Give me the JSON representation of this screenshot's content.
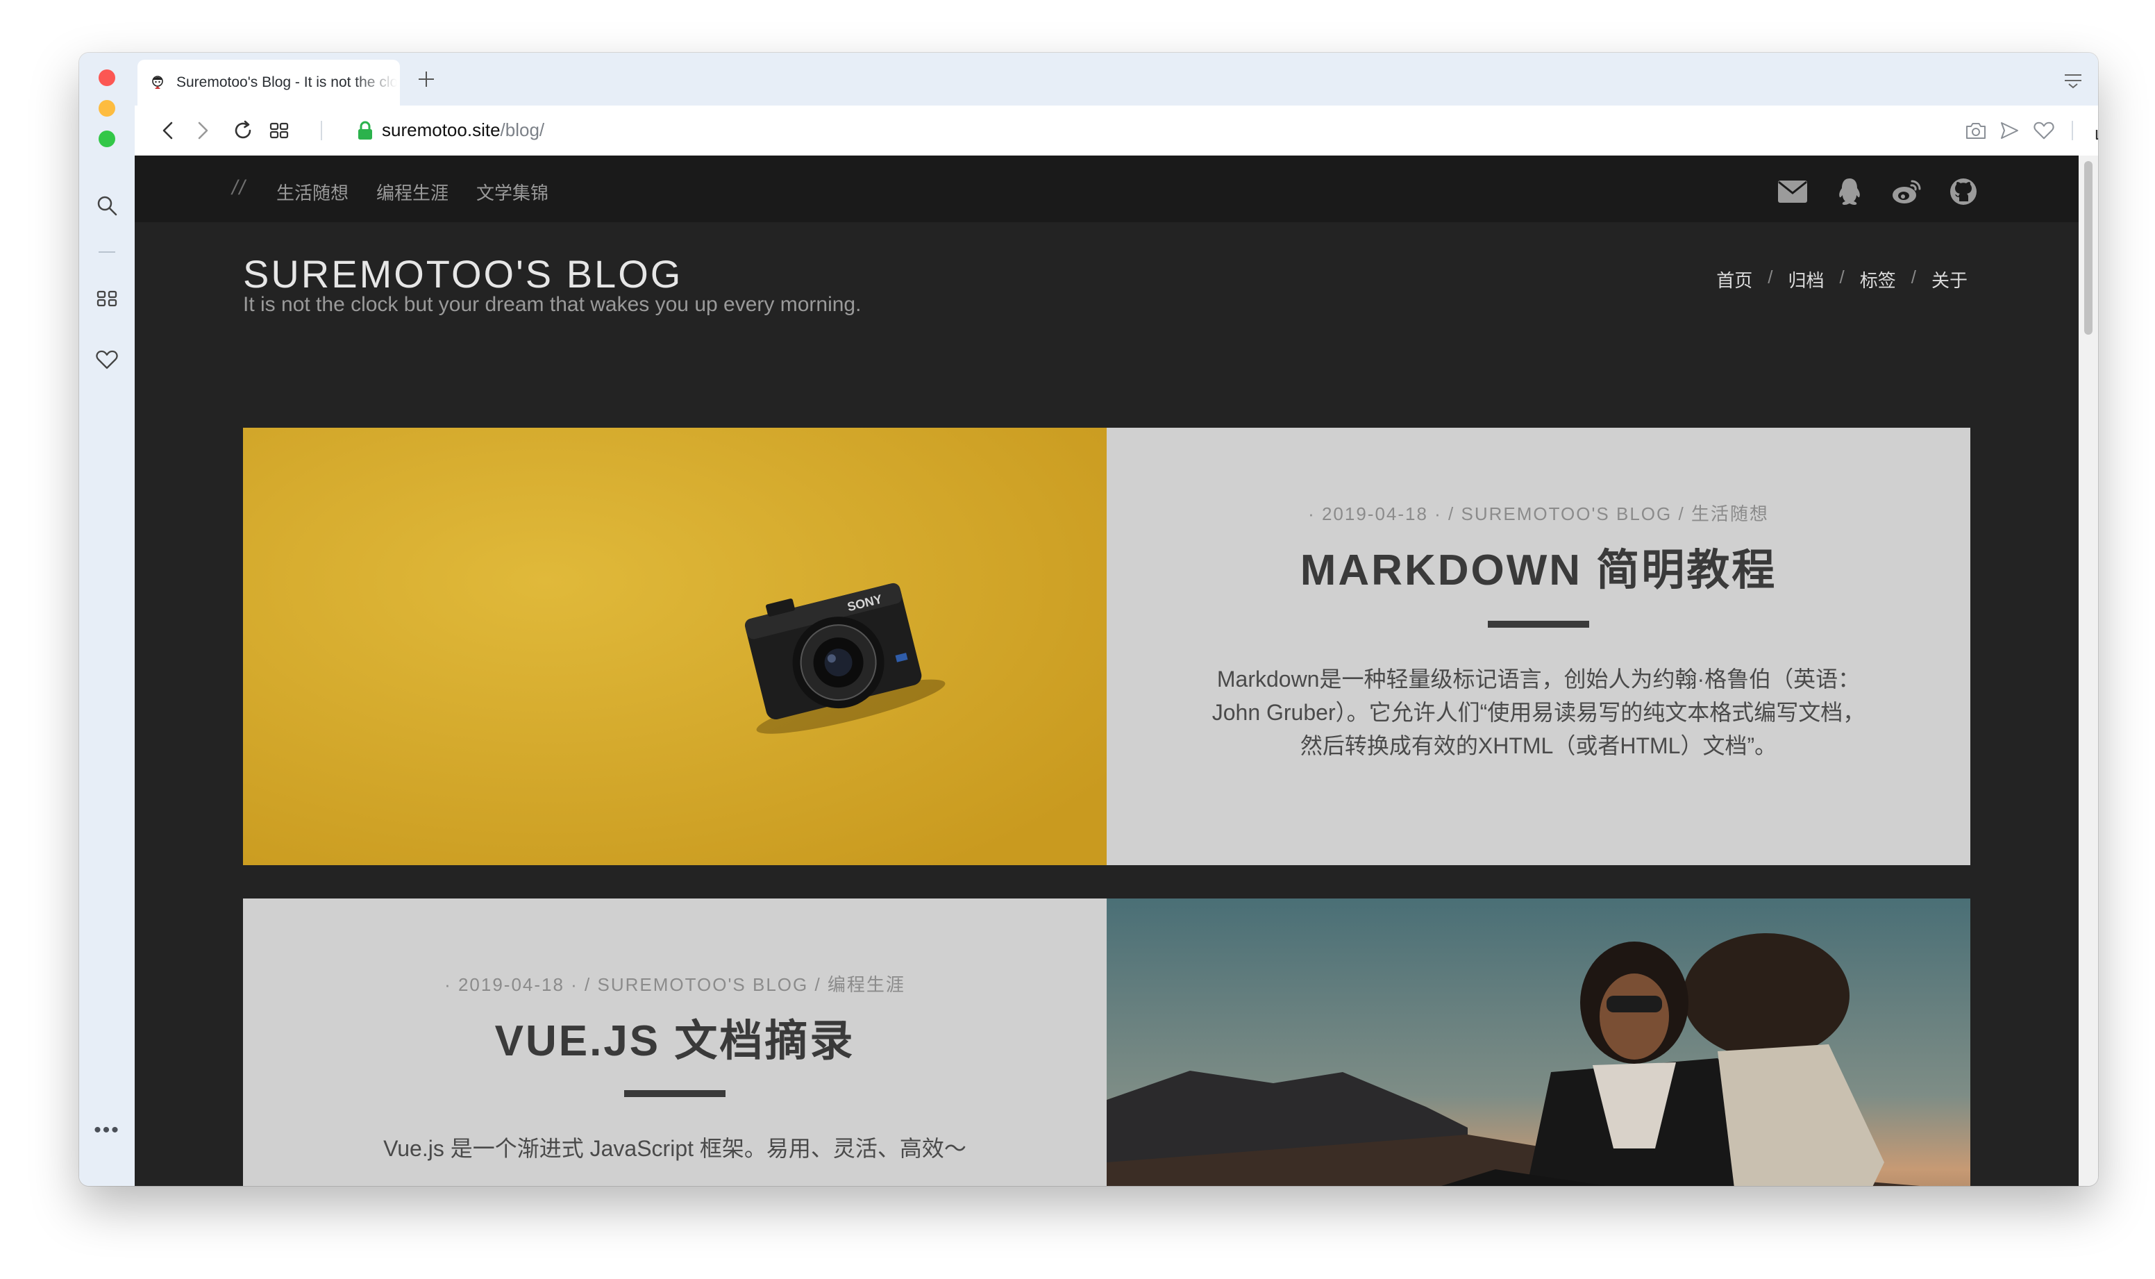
{
  "browser": {
    "tab_title": "Suremotoo's Blog - It is not the clock but your dream that wakes you up every morning.",
    "url_host": "suremotoo.site",
    "url_path": "/blog/",
    "colors": {
      "traffic_red": "#fc5753",
      "traffic_yellow": "#fdbc40",
      "traffic_green": "#33c748",
      "secure_lock": "#2bb24c"
    },
    "toolbar_icons": [
      "back-icon",
      "forward-icon",
      "reload-icon",
      "speed-dial-icon",
      "lock-icon",
      "camera-icon",
      "send-icon",
      "heart-icon",
      "share-icon",
      "settings-icon"
    ],
    "sidebar_icons": [
      "search-icon",
      "apps-icon",
      "heart-icon",
      "more-icon"
    ],
    "sidebar_more": "•••"
  },
  "site": {
    "nav_slash": "//",
    "top_nav": [
      "生活随想",
      "编程生涯",
      "文学集锦"
    ],
    "social_icons": [
      "mail-icon",
      "qq-icon",
      "weibo-icon",
      "github-icon"
    ],
    "title": "SUREMOTOO'S BLOG",
    "subtitle": "It is not the clock but your dream that wakes you up every morning.",
    "main_nav": [
      "首页",
      "归档",
      "标签",
      "关于"
    ],
    "main_nav_sep": "/",
    "colors": {
      "page_bg": "#232323",
      "card_bg": "#d0d0d0",
      "camera_bg": "#d8ad2d"
    }
  },
  "posts": [
    {
      "meta": "· 2019-04-18 · / SUREMOTOO'S BLOG / 生活随想",
      "title": "MARKDOWN 简明教程",
      "excerpt": "Markdown是一种轻量级标记语言，创始人为约翰·格鲁伯（英语：John Gruber）。它允许人们“使用易读易写的纯文本格式编写文档，然后转换成有效的XHTML（或者HTML）文档”。",
      "image": "camera-photo",
      "camera_brand": "SONY"
    },
    {
      "meta": "· 2019-04-18 · / SUREMOTOO'S BLOG / 编程生涯",
      "title": "VUE.JS 文档摘录",
      "excerpt": "Vue.js 是一个渐进式 JavaScript 框架。易用、灵活、高效～",
      "image": "motorcycle-couple-photo"
    }
  ]
}
